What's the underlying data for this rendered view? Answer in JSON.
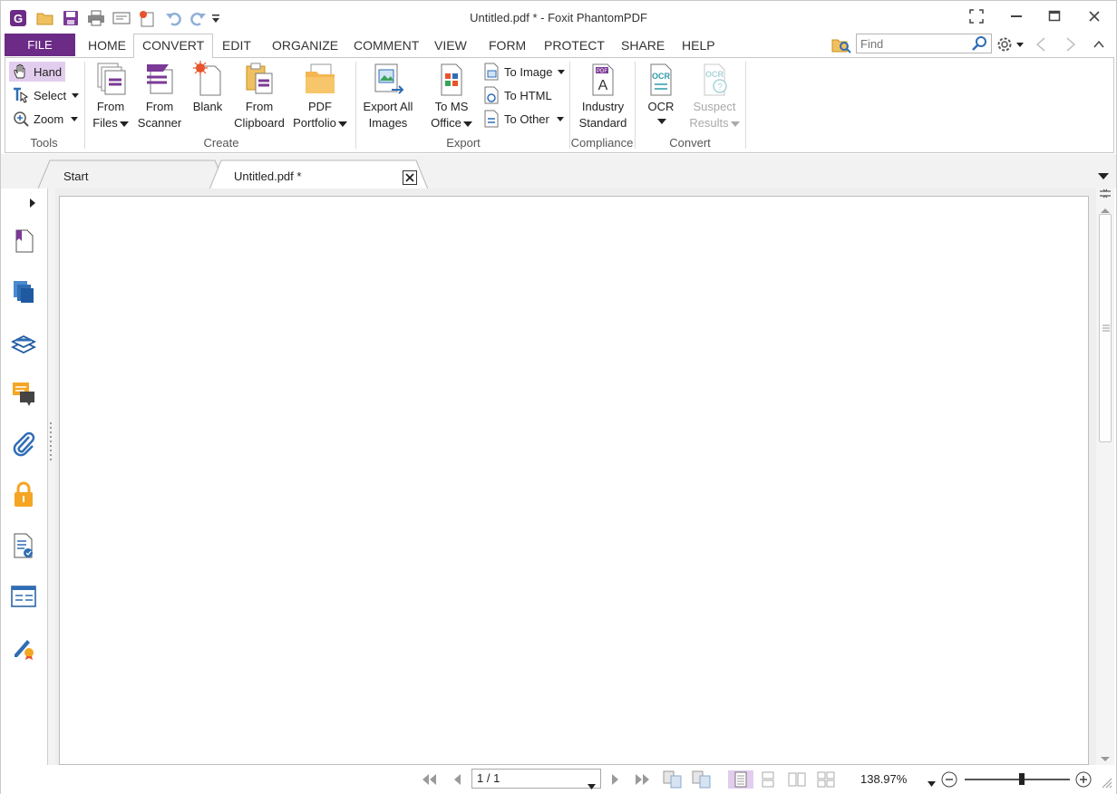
{
  "titlebar": {
    "title": "Untitled.pdf * - Foxit PhantomPDF",
    "quick_access": [
      "app-logo-icon",
      "open-folder-icon",
      "save-icon",
      "print-icon",
      "email-icon",
      "new-icon",
      "undo-icon",
      "redo-icon",
      "customize-icon"
    ]
  },
  "menu": {
    "file": "FILE",
    "tabs": [
      "HOME",
      "CONVERT",
      "EDIT",
      "ORGANIZE",
      "COMMENT",
      "VIEW",
      "FORM",
      "PROTECT",
      "SHARE",
      "HELP"
    ],
    "active_tab": "CONVERT",
    "find_placeholder": "Find"
  },
  "ribbon": {
    "tools": {
      "hand": "Hand",
      "select": "Select",
      "zoom": "Zoom",
      "group": "Tools"
    },
    "create": {
      "from_files": [
        "From",
        "Files"
      ],
      "from_scanner": [
        "From",
        "Scanner"
      ],
      "blank": "Blank",
      "from_clipboard": [
        "From",
        "Clipboard"
      ],
      "pdf_portfolio": [
        "PDF",
        "Portfolio"
      ],
      "group": "Create"
    },
    "export": {
      "export_all_images": [
        "Export All",
        "Images"
      ],
      "to_ms_office": [
        "To MS",
        "Office"
      ],
      "to_image": "To Image",
      "to_html": "To HTML",
      "to_other": "To Other",
      "group": "Export"
    },
    "compliance": {
      "industry_standard": [
        "Industry",
        "Standard"
      ],
      "group": "Compliance"
    },
    "convert": {
      "ocr": "OCR",
      "suspect_results": [
        "Suspect",
        "Results"
      ],
      "group": "Convert"
    }
  },
  "doc_tabs": {
    "start": "Start",
    "current": "Untitled.pdf *"
  },
  "status": {
    "page": "1 / 1",
    "zoom": "138.97%"
  },
  "colors": {
    "accent": "#6b2b86",
    "hand_highlight": "#e2cdee",
    "icon_blue": "#2f6db5"
  }
}
